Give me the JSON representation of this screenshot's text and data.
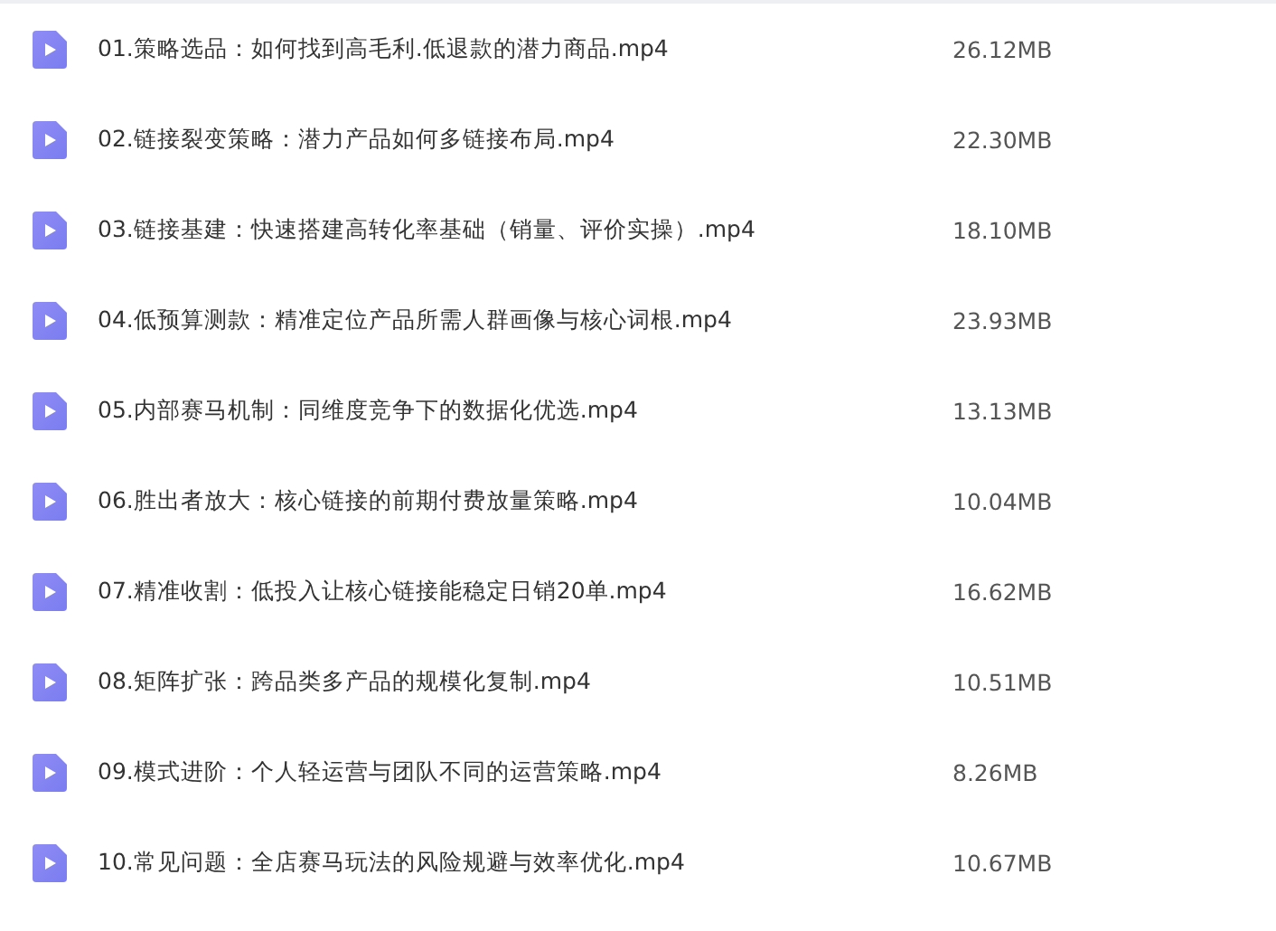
{
  "files": [
    {
      "name": "01.策略选品：如何找到高毛利.低退款的潜力商品.mp4",
      "size": "26.12MB"
    },
    {
      "name": "02.链接裂变策略：潜力产品如何多链接布局.mp4",
      "size": "22.30MB"
    },
    {
      "name": "03.链接基建：快速搭建高转化率基础（销量、评价实操）.mp4",
      "size": "18.10MB"
    },
    {
      "name": "04.低预算测款：精准定位产品所需人群画像与核心词根.mp4",
      "size": "23.93MB"
    },
    {
      "name": "05.内部赛马机制：同维度竞争下的数据化优选.mp4",
      "size": "13.13MB"
    },
    {
      "name": "06.胜出者放大：核心链接的前期付费放量策略.mp4",
      "size": "10.04MB"
    },
    {
      "name": "07.精准收割：低投入让核心链接能稳定日销20单.mp4",
      "size": "16.62MB"
    },
    {
      "name": "08.矩阵扩张：跨品类多产品的规模化复制.mp4",
      "size": "10.51MB"
    },
    {
      "name": "09.模式进阶：个人轻运营与团队不同的运营策略.mp4",
      "size": "8.26MB"
    },
    {
      "name": "10.常见问题：全店赛马玩法的风险规避与效率优化.mp4",
      "size": "10.67MB"
    }
  ]
}
